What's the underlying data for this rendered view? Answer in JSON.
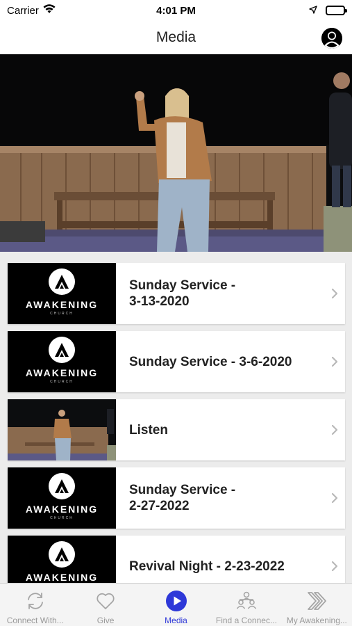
{
  "status_bar": {
    "carrier": "Carrier",
    "time": "4:01 PM"
  },
  "nav": {
    "title": "Media",
    "profile_icon": "person-circle-icon"
  },
  "hero": {
    "description_icon": "hero-image"
  },
  "thumbnail_logo": {
    "word": "AWAKENING",
    "sub": "CHURCH"
  },
  "media_items": [
    {
      "title_line1": "Sunday Service -",
      "title_line2": "3-13-2020",
      "thumb": "awakening-logo"
    },
    {
      "title_line1": "Sunday Service - 3-6-2020",
      "title_line2": "",
      "thumb": "awakening-logo"
    },
    {
      "title_line1": "Listen",
      "title_line2": "",
      "thumb": "stage-photo"
    },
    {
      "title_line1": "Sunday Service -",
      "title_line2": "2-27-2022",
      "thumb": "awakening-logo"
    },
    {
      "title_line1": "Revival Night - 2-23-2022",
      "title_line2": "",
      "thumb": "awakening-logo"
    }
  ],
  "tabs": [
    {
      "label": "Connect With...",
      "icon": "refresh-icon",
      "active": false
    },
    {
      "label": "Give",
      "icon": "heart-icon",
      "active": false
    },
    {
      "label": "Media",
      "icon": "play-circle-icon",
      "active": true
    },
    {
      "label": "Find a Connec...",
      "icon": "people-icon",
      "active": false
    },
    {
      "label": "My Awakening...",
      "icon": "double-chevron-icon",
      "active": false
    }
  ],
  "colors": {
    "accent": "#2e38d8",
    "tab_inactive": "#9a9a9a",
    "background": "#ececec"
  }
}
